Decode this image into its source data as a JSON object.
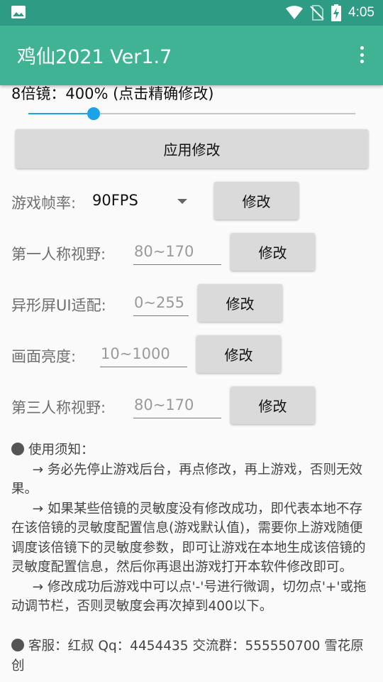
{
  "status_bar": {
    "time": "4:05",
    "icons": [
      "image-icon",
      "wifi-icon",
      "no-sim-icon",
      "battery-charging-icon"
    ]
  },
  "app_bar": {
    "title": "鸡仙2021 Ver1.7",
    "menu_icon": "more-vert-icon"
  },
  "zoom": {
    "label": "8倍镜：400%  (点击精确修改)",
    "slider_fraction": 0.2
  },
  "apply_button": "应用修改",
  "fps": {
    "label": "游戏帧率:",
    "value": "90FPS",
    "button": "修改"
  },
  "fpp_fov": {
    "label": "第一人称视野:",
    "placeholder": "80~170",
    "button": "修改"
  },
  "notch_ui": {
    "label": "异形屏UI适配:",
    "placeholder": "0~255",
    "button": "修改"
  },
  "brightness": {
    "label": "画面亮度:",
    "placeholder": "10~1000",
    "button": "修改"
  },
  "tpp_fov": {
    "label": "第三人称视野:",
    "placeholder": "80~170",
    "button": "修改"
  },
  "notice": {
    "heading": "使用须知：",
    "items": [
      "→ 务必先停止游戏后台，再点修改，再上游戏，否则无效果。",
      "→ 如果某些倍镜的灵敏度没有修改成功，即代表本地不存在该倍镜的灵敏度配置信息(游戏默认值)，需要你上游戏随便调度该倍镜下的灵敏度参数，即可让游戏在本地生成该倍镜的灵敏度配置信息，然后你再退出游戏打开本软件修改即可。",
      "→ 修改成功后游戏中可以点'-'号进行微调，切勿点'+'或拖动调节栏，否则灵敏度会再次掉到400以下。"
    ]
  },
  "contact": "客服：红叔  Qq：4454435  交流群：555550700 雪花原创",
  "colors": {
    "status_bar": "#2e9b84",
    "app_bar": "#40b394",
    "slider_accent": "#1aa3e8",
    "button_bg": "#dadada"
  }
}
